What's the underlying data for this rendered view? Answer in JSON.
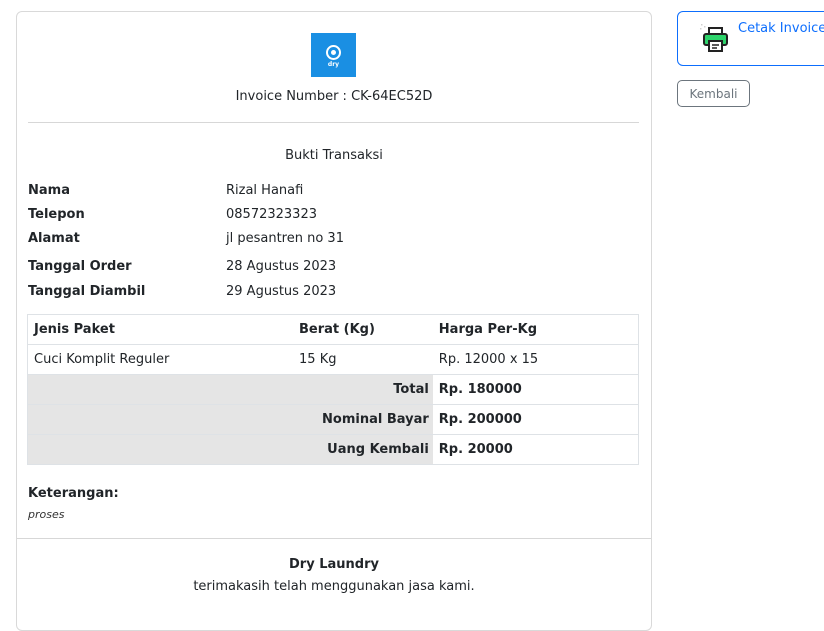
{
  "invoice": {
    "logo_text": "dry",
    "number_label": "Invoice Number : CK-64EC52D",
    "title": "Bukti Transaksi"
  },
  "customer": {
    "rows": [
      {
        "label": "Nama",
        "value": "Rizal Hanafi"
      },
      {
        "label": "Telepon",
        "value": "08572323323"
      },
      {
        "label": "Alamat",
        "value": "jl pesantren no 31"
      },
      {
        "label": "Tanggal Order",
        "value": "28 Agustus 2023"
      },
      {
        "label": "Tanggal Diambil",
        "value": "29 Agustus 2023"
      }
    ]
  },
  "table": {
    "headers": [
      "Jenis Paket",
      "Berat (Kg)",
      "Harga Per-Kg"
    ],
    "row": [
      "Cuci Komplit Reguler",
      "15 Kg",
      "Rp. 12000 x 15"
    ],
    "summary": [
      {
        "label": "Total",
        "value": "Rp. 180000"
      },
      {
        "label": "Nominal Bayar",
        "value": "Rp. 200000"
      },
      {
        "label": "Uang Kembali",
        "value": "Rp. 20000"
      }
    ]
  },
  "notes": {
    "label": "Keterangan:",
    "value": "proses"
  },
  "footer": {
    "company": "Dry Laundry",
    "thanks": "terimakasih telah menggunakan jasa kami."
  },
  "actions": {
    "print_label": "Cetak Invoice",
    "back_label": "Kembali",
    "print_icon": "printer-icon"
  },
  "colors": {
    "primary": "#0d6efd",
    "logo_bg": "#1a8fe3",
    "secondary": "#6c757d",
    "summary_bg": "#e5e5e5"
  }
}
